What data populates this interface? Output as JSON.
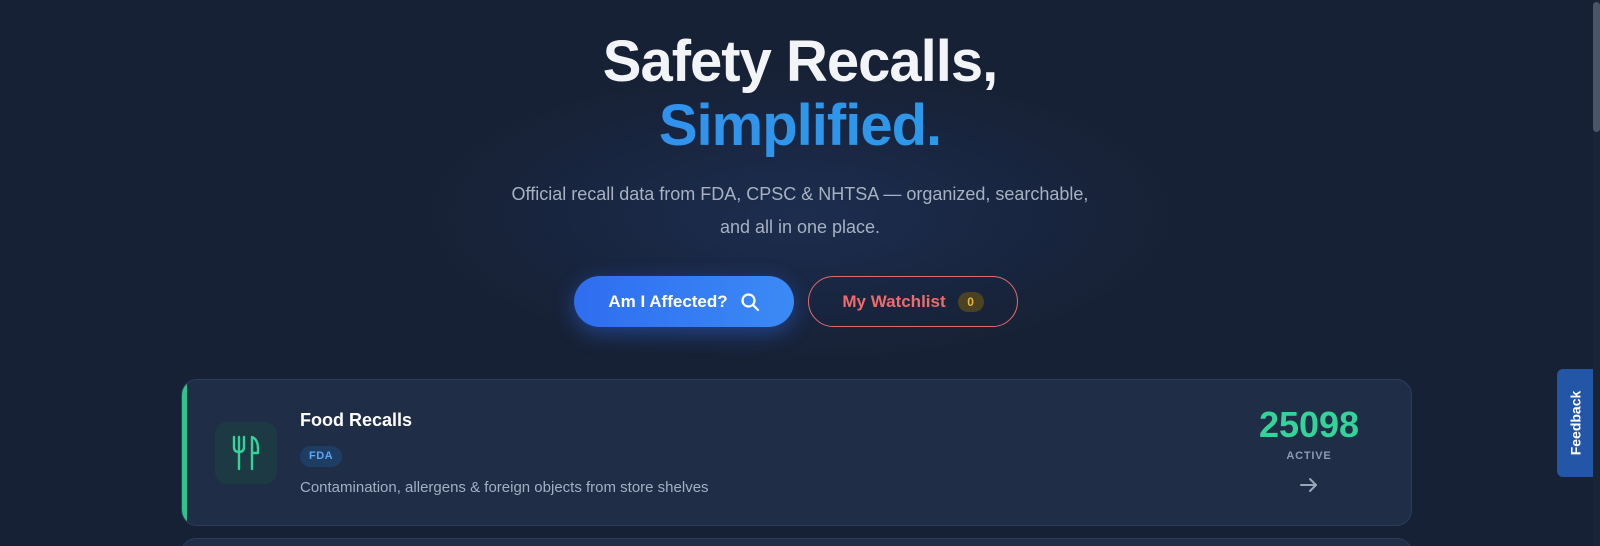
{
  "hero": {
    "title_line1": "Safety Recalls,",
    "title_line2": "Simplified.",
    "subtitle_line1": "Official recall data from FDA, CPSC & NHTSA — organized, searchable,",
    "subtitle_line2": "and all in one place."
  },
  "actions": {
    "primary_label": "Am I Affected?",
    "primary_icon": "search-icon",
    "watchlist_label": "My Watchlist",
    "watchlist_count": "0"
  },
  "categories": [
    {
      "title": "Food Recalls",
      "agency": "FDA",
      "description": "Contamination, allergens & foreign objects from store shelves",
      "count": "25098",
      "count_label": "ACTIVE",
      "icon": "utensils-icon",
      "accent_color": "#2fc48a",
      "arrow_icon": "arrow-right-icon"
    }
  ],
  "feedback": {
    "label": "Feedback"
  },
  "colors": {
    "background": "#172135",
    "primary": "#3b82f6",
    "danger": "#ef6b6b",
    "success": "#34d399"
  }
}
